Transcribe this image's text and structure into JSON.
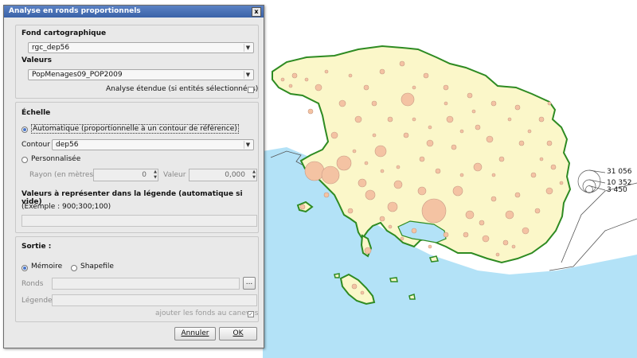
{
  "dialog": {
    "title": "Analyse en ronds proportionnels",
    "close_glyph": "x",
    "fond_label": "Fond cartographique",
    "fond_value": "rgc_dep56",
    "valeurs_label": "Valeurs",
    "valeurs_value": "PopMenages09_POP2009",
    "analyse_etendue": "Analyse étendue (si entités sélectionnées)",
    "echelle_label": "Échelle",
    "automatique": "Automatique (proportionnelle à un contour de référence)",
    "contour_label": "Contour",
    "contour_value": "dep56",
    "personnalisee": "Personnalisée",
    "rayon_label": "Rayon (en mètres)",
    "rayon_value": "0",
    "valeur_label": "Valeur",
    "valeur_value": "0,000",
    "legende_values_label": "Valeurs à représenter dans la légende (automatique si vide)",
    "exemple": "(Exemple : 900;300;100)",
    "sortie_label": "Sortie :",
    "memoire": "Mémoire",
    "shapefile": "Shapefile",
    "ronds_label": "Ronds",
    "browse": "...",
    "legende_label": "Légende",
    "ajouter": "ajouter les fonds au canevas",
    "annuler": "Annuler",
    "ok": "OK"
  },
  "map_legend": {
    "values": [
      "31 056",
      "10 352",
      "3 450"
    ]
  },
  "colors": {
    "sea": "#b3e2f7",
    "land": "#fbf7c9",
    "border": "#2e8b22",
    "circle_fill": "#f4c3a3",
    "circle_stroke": "#c89a85"
  }
}
